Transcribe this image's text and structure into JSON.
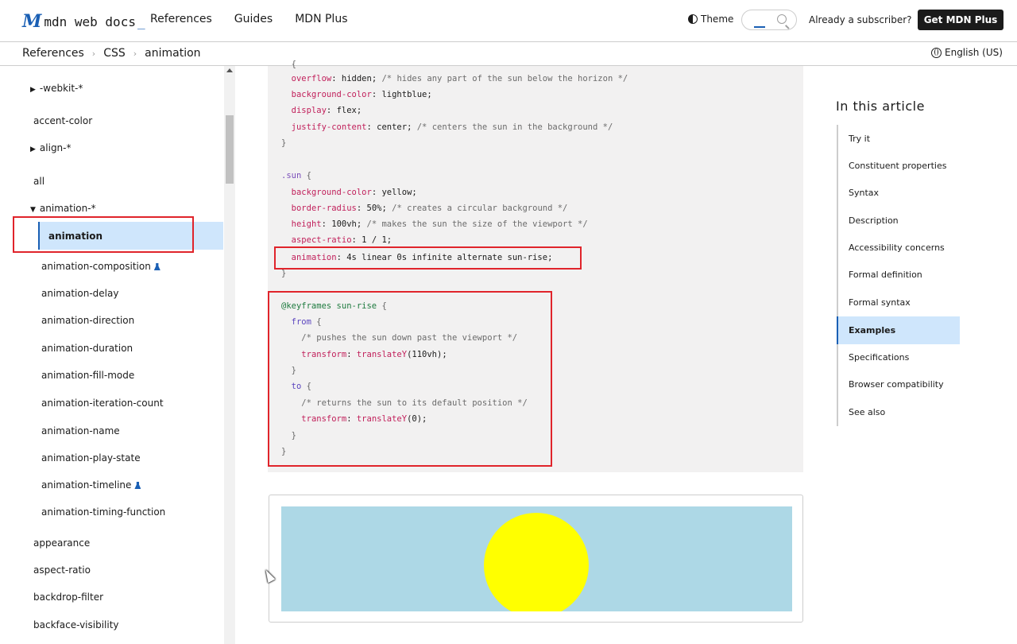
{
  "header": {
    "logo_mark": "M",
    "logo_text": "mdn web docs",
    "logo_underscore": "_",
    "nav": [
      "References",
      "Guides",
      "MDN Plus"
    ],
    "theme_label": "Theme",
    "subscriber_text": "Already a subscriber?",
    "get_plus_label": "Get MDN Plus"
  },
  "breadcrumb": {
    "items": [
      "References",
      "CSS",
      "animation"
    ],
    "language": "English (US)"
  },
  "sidebar": {
    "items": [
      {
        "label": "-webkit-*",
        "expander": "▶"
      },
      {
        "label": "accent-color"
      },
      {
        "label": "align-*",
        "expander": "▶"
      },
      {
        "label": "all"
      },
      {
        "label": "animation-*",
        "expander": "▼"
      },
      {
        "label": "animation",
        "active": true
      },
      {
        "label": "animation-composition",
        "experimental": true
      },
      {
        "label": "animation-delay"
      },
      {
        "label": "animation-direction"
      },
      {
        "label": "animation-duration"
      },
      {
        "label": "animation-fill-mode"
      },
      {
        "label": "animation-iteration-count"
      },
      {
        "label": "animation-name"
      },
      {
        "label": "animation-play-state"
      },
      {
        "label": "animation-timeline",
        "experimental": true
      },
      {
        "label": "animation-timing-function"
      },
      {
        "label": "appearance"
      },
      {
        "label": "aspect-ratio"
      },
      {
        "label": "backdrop-filter"
      },
      {
        "label": "backface-visibility"
      }
    ]
  },
  "code": {
    "lines": [
      {
        "prop": "overflow",
        "value": "hidden;",
        "comment": "/* hides any part of the sun below the horizon */"
      },
      {
        "prop": "background-color",
        "value": "lightblue;"
      },
      {
        "prop": "display",
        "value": "flex;"
      },
      {
        "prop": "justify-content",
        "value": "center;",
        "comment": "/* centers the sun in the background */"
      },
      {
        "text": "}"
      },
      {
        "selector": ".sun",
        "text": "{"
      },
      {
        "prop": "background-color",
        "value": "yellow;"
      },
      {
        "prop": "border-radius",
        "value": "50%;",
        "comment": "/* creates a circular background */"
      },
      {
        "prop": "height",
        "value": "100vh;",
        "comment": "/* makes the sun the size of the viewport */"
      },
      {
        "prop": "aspect-ratio",
        "value": "1 / 1;"
      },
      {
        "prop": "animation",
        "value": "4s linear 0s infinite alternate sun-rise;"
      },
      {
        "text": "}"
      },
      {
        "at": "@keyframes",
        "name": "sun-rise",
        "text": "{"
      },
      {
        "kw": "from",
        "text": "{"
      },
      {
        "comment": "/* pushes the sun down past the viewport */"
      },
      {
        "prop": "transform",
        "fn": "translateY",
        "arg": "(110vh);"
      },
      {
        "text": "}"
      },
      {
        "kw": "to",
        "text": "{"
      },
      {
        "comment": "/* returns the sun to its default position */"
      },
      {
        "prop": "transform",
        "fn": "translateY",
        "arg": "(0);"
      },
      {
        "text": "}"
      },
      {
        "text": "}"
      }
    ],
    "fragment_top": "{"
  },
  "preview": {
    "sky_color": "#add8e6",
    "sun_color": "#ffff00"
  },
  "toc": {
    "title": "In this article",
    "items": [
      "Try it",
      "Constituent properties",
      "Syntax",
      "Description",
      "Accessibility concerns",
      "Formal definition",
      "Formal syntax",
      "Examples",
      "Specifications",
      "Browser compatibility",
      "See also"
    ],
    "active": "Examples"
  },
  "colors": {
    "accent": "#1a5fb4",
    "annotation_red": "#e0242b",
    "active_bg": "#cfe6fc"
  }
}
